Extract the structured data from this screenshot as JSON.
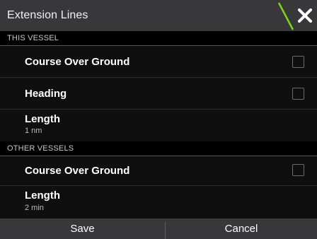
{
  "dialog": {
    "title": "Extension Lines",
    "close_icon": "close-icon",
    "accent_color": "#7ed321"
  },
  "sections": {
    "this_vessel": {
      "label": "THIS VESSEL",
      "cog_label": "Course Over Ground",
      "cog_checked": false,
      "heading_label": "Heading",
      "heading_checked": false,
      "length_label": "Length",
      "length_value": "1 nm"
    },
    "other_vessels": {
      "label": "OTHER VESSELS",
      "cog_label": "Course Over Ground",
      "cog_checked": false,
      "length_label": "Length",
      "length_value": "2 min"
    }
  },
  "footer": {
    "save_label": "Save",
    "cancel_label": "Cancel"
  }
}
